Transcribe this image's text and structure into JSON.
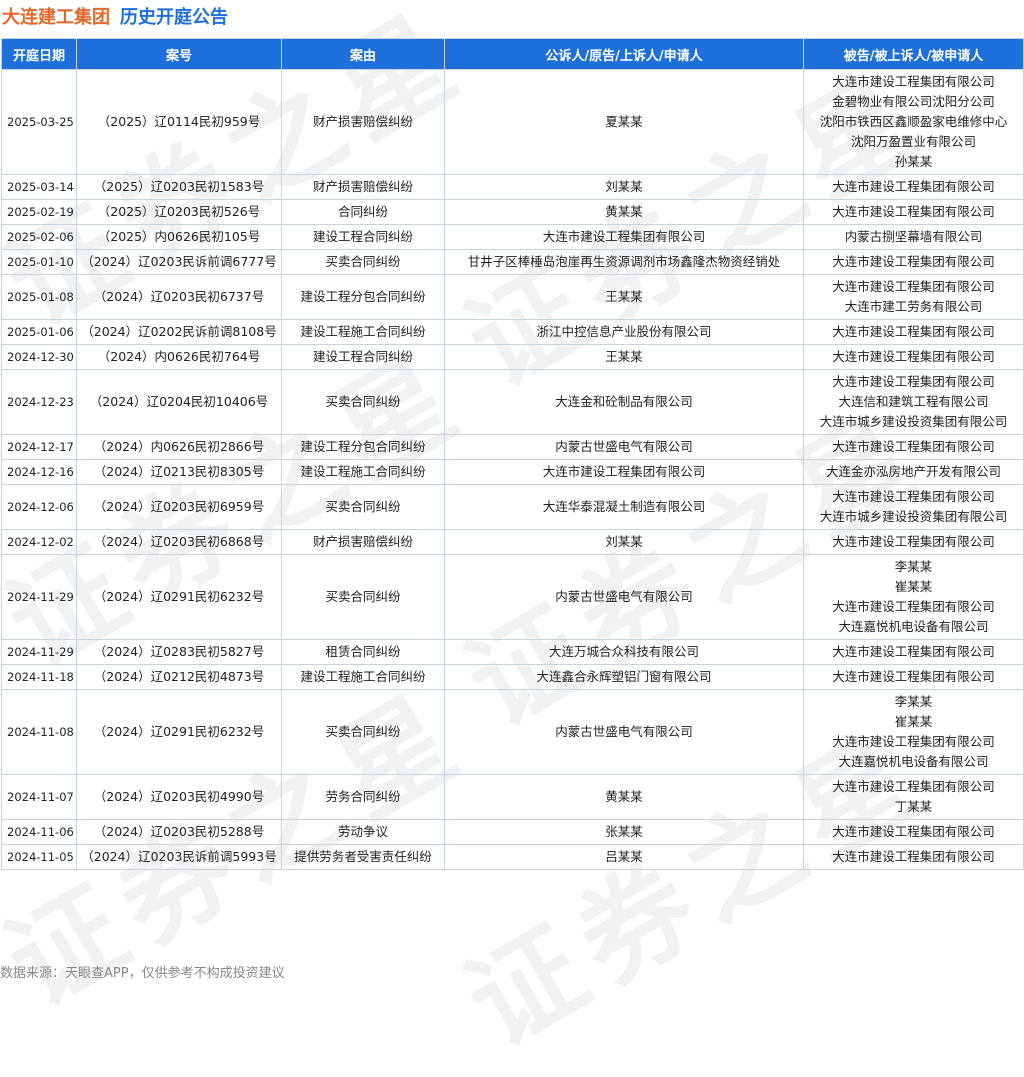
{
  "header": {
    "company": "大连建工集团",
    "subtitle": "历史开庭公告"
  },
  "watermark_text": "证券之星",
  "columns": [
    "开庭日期",
    "案号",
    "案由",
    "公诉人/原告/上诉人/申请人",
    "被告/被上诉人/被申请人"
  ],
  "rows": [
    {
      "date": "2025-03-25",
      "case_no": "（2025）辽0114民初959号",
      "cause": "财产损害赔偿纠纷",
      "plaintiff": "夏某某",
      "defendants": [
        "大连市建设工程集团有限公司",
        "金碧物业有限公司沈阳分公司",
        "沈阳市铁西区鑫顺盈家电维修中心",
        "沈阳万盈置业有限公司",
        "孙某某"
      ]
    },
    {
      "date": "2025-03-14",
      "case_no": "（2025）辽0203民初1583号",
      "cause": "财产损害赔偿纠纷",
      "plaintiff": "刘某某",
      "defendants": [
        "大连市建设工程集团有限公司"
      ]
    },
    {
      "date": "2025-02-19",
      "case_no": "（2025）辽0203民初526号",
      "cause": "合同纠纷",
      "plaintiff": "黄某某",
      "defendants": [
        "大连市建设工程集团有限公司"
      ]
    },
    {
      "date": "2025-02-06",
      "case_no": "（2025）内0626民初105号",
      "cause": "建设工程合同纠纷",
      "plaintiff": "大连市建设工程集团有限公司",
      "defendants": [
        "内蒙古捌坚幕墙有限公司"
      ]
    },
    {
      "date": "2025-01-10",
      "case_no": "（2024）辽0203民诉前调6777号",
      "cause": "买卖合同纠纷",
      "plaintiff": "甘井子区棒棰岛泡崖再生资源调剂市场鑫隆杰物资经销处",
      "defendants": [
        "大连市建设工程集团有限公司"
      ]
    },
    {
      "date": "2025-01-08",
      "case_no": "（2024）辽0203民初6737号",
      "cause": "建设工程分包合同纠纷",
      "plaintiff": "王某某",
      "defendants": [
        "大连市建设工程集团有限公司",
        "大连市建工劳务有限公司"
      ]
    },
    {
      "date": "2025-01-06",
      "case_no": "（2024）辽0202民诉前调8108号",
      "cause": "建设工程施工合同纠纷",
      "plaintiff": "浙江中控信息产业股份有限公司",
      "defendants": [
        "大连市建设工程集团有限公司"
      ]
    },
    {
      "date": "2024-12-30",
      "case_no": "（2024）内0626民初764号",
      "cause": "建设工程合同纠纷",
      "plaintiff": "王某某",
      "defendants": [
        "大连市建设工程集团有限公司"
      ]
    },
    {
      "date": "2024-12-23",
      "case_no": "（2024）辽0204民初10406号",
      "cause": "买卖合同纠纷",
      "plaintiff": "大连金和砼制品有限公司",
      "defendants": [
        "大连市建设工程集团有限公司",
        "大连信和建筑工程有限公司",
        "大连市城乡建设投资集团有限公司"
      ]
    },
    {
      "date": "2024-12-17",
      "case_no": "（2024）内0626民初2866号",
      "cause": "建设工程分包合同纠纷",
      "plaintiff": "内蒙古世盛电气有限公司",
      "defendants": [
        "大连市建设工程集团有限公司"
      ]
    },
    {
      "date": "2024-12-16",
      "case_no": "（2024）辽0213民初8305号",
      "cause": "建设工程施工合同纠纷",
      "plaintiff": "大连市建设工程集团有限公司",
      "defendants": [
        "大连金亦泓房地产开发有限公司"
      ]
    },
    {
      "date": "2024-12-06",
      "case_no": "（2024）辽0203民初6959号",
      "cause": "买卖合同纠纷",
      "plaintiff": "大连华泰混凝土制造有限公司",
      "defendants": [
        "大连市建设工程集团有限公司",
        "大连市城乡建设投资集团有限公司"
      ]
    },
    {
      "date": "2024-12-02",
      "case_no": "（2024）辽0203民初6868号",
      "cause": "财产损害赔偿纠纷",
      "plaintiff": "刘某某",
      "defendants": [
        "大连市建设工程集团有限公司"
      ]
    },
    {
      "date": "2024-11-29",
      "case_no": "（2024）辽0291民初6232号",
      "cause": "买卖合同纠纷",
      "plaintiff": "内蒙古世盛电气有限公司",
      "defendants": [
        "李某某",
        "崔某某",
        "大连市建设工程集团有限公司",
        "大连嘉悦机电设备有限公司"
      ]
    },
    {
      "date": "2024-11-29",
      "case_no": "（2024）辽0283民初5827号",
      "cause": "租赁合同纠纷",
      "plaintiff": "大连万城合众科技有限公司",
      "defendants": [
        "大连市建设工程集团有限公司"
      ]
    },
    {
      "date": "2024-11-18",
      "case_no": "（2024）辽0212民初4873号",
      "cause": "建设工程施工合同纠纷",
      "plaintiff": "大连鑫合永辉塑铝门窗有限公司",
      "defendants": [
        "大连市建设工程集团有限公司"
      ]
    },
    {
      "date": "2024-11-08",
      "case_no": "（2024）辽0291民初6232号",
      "cause": "买卖合同纠纷",
      "plaintiff": "内蒙古世盛电气有限公司",
      "defendants": [
        "李某某",
        "崔某某",
        "大连市建设工程集团有限公司",
        "大连嘉悦机电设备有限公司"
      ]
    },
    {
      "date": "2024-11-07",
      "case_no": "（2024）辽0203民初4990号",
      "cause": "劳务合同纠纷",
      "plaintiff": "黄某某",
      "defendants": [
        "大连市建设工程集团有限公司",
        "丁某某"
      ]
    },
    {
      "date": "2024-11-06",
      "case_no": "（2024）辽0203民初5288号",
      "cause": "劳动争议",
      "plaintiff": "张某某",
      "defendants": [
        "大连市建设工程集团有限公司"
      ]
    },
    {
      "date": "2024-11-05",
      "case_no": "（2024）辽0203民诉前调5993号",
      "cause": "提供劳务者受害责任纠纷",
      "plaintiff": "吕某某",
      "defendants": [
        "大连市建设工程集团有限公司"
      ]
    }
  ],
  "footer": "数据来源：天眼查APP，仅供参考不构成投资建议",
  "colors": {
    "header_bg": "#1e6fd9",
    "company_title": "#e0692b",
    "subtitle": "#1e6fd9",
    "border": "#c9d3e0",
    "footer_text": "#888888"
  }
}
